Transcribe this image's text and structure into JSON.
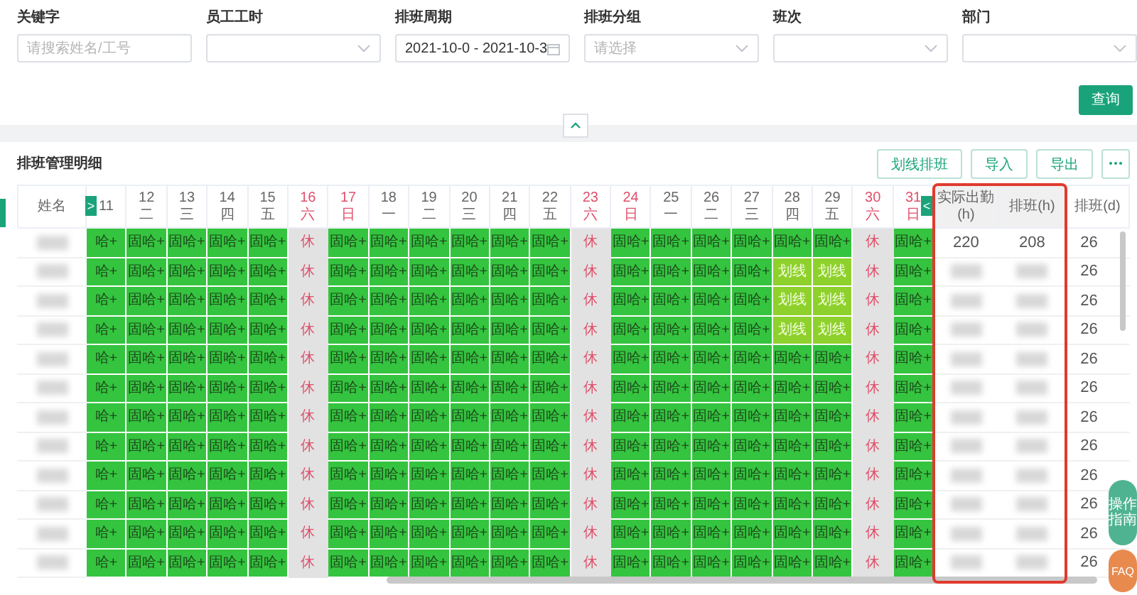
{
  "filters": [
    {
      "label": "关键字",
      "kind": "input",
      "placeholder": "请搜索姓名/工号"
    },
    {
      "label": "员工工时",
      "kind": "select"
    },
    {
      "label": "排班周期",
      "kind": "date",
      "value": "2021-10-0 - 2021-10-3"
    },
    {
      "label": "排班分组",
      "kind": "select",
      "placeholder": "请选择"
    },
    {
      "label": "班次",
      "kind": "select"
    },
    {
      "label": "部门",
      "kind": "select"
    }
  ],
  "query_button": "查询",
  "section_title": "排班管理明细",
  "toolbar_buttons": [
    "划线排班",
    "导入",
    "导出"
  ],
  "table": {
    "name_header": "姓名",
    "scroll_left": ">",
    "scroll_right": "<",
    "days": [
      {
        "day": "11",
        "weekend": false
      },
      {
        "day": "12",
        "weekday": "二",
        "weekend": false
      },
      {
        "day": "13",
        "weekday": "三",
        "weekend": false
      },
      {
        "day": "14",
        "weekday": "四",
        "weekend": false
      },
      {
        "day": "15",
        "weekday": "五",
        "weekend": false
      },
      {
        "day": "16",
        "weekday": "六",
        "weekend": true
      },
      {
        "day": "17",
        "weekday": "日",
        "weekend": true
      },
      {
        "day": "18",
        "weekday": "一",
        "weekend": false
      },
      {
        "day": "19",
        "weekday": "二",
        "weekend": false
      },
      {
        "day": "20",
        "weekday": "三",
        "weekend": false
      },
      {
        "day": "21",
        "weekday": "四",
        "weekend": false
      },
      {
        "day": "22",
        "weekday": "五",
        "weekend": false
      },
      {
        "day": "23",
        "weekday": "六",
        "weekend": true
      },
      {
        "day": "24",
        "weekday": "日",
        "weekend": true
      },
      {
        "day": "25",
        "weekday": "一",
        "weekend": false
      },
      {
        "day": "26",
        "weekday": "二",
        "weekend": false
      },
      {
        "day": "27",
        "weekday": "三",
        "weekend": false
      },
      {
        "day": "28",
        "weekday": "四",
        "weekend": false
      },
      {
        "day": "29",
        "weekday": "五",
        "weekend": false
      },
      {
        "day": "30",
        "weekday": "六",
        "weekend": true
      },
      {
        "day": "31",
        "weekday": "日",
        "weekend": true
      }
    ],
    "summary_headers": [
      {
        "text": "实际出勤(h)",
        "highlighted": true
      },
      {
        "text": "排班(h)",
        "highlighted": true
      },
      {
        "text": "排班(d)",
        "highlighted": false
      }
    ],
    "rows": [
      {
        "cells": [
          "哈+",
          "固哈+",
          "固哈+",
          "固哈+",
          "固哈+",
          "休",
          "固哈+",
          "固哈+",
          "固哈+",
          "固哈+",
          "固哈+",
          "固哈+",
          "休",
          "固哈+",
          "固哈+",
          "固哈+",
          "固哈+",
          "固哈+",
          "固哈+",
          "休",
          "固哈+"
        ],
        "actual_hours": "220",
        "scheduled_hours": "208",
        "scheduled_days": "26"
      },
      {
        "cells": [
          "哈+",
          "固哈+",
          "固哈+",
          "固哈+",
          "固哈+",
          "休",
          "固哈+",
          "固哈+",
          "固哈+",
          "固哈+",
          "固哈+",
          "固哈+",
          "休",
          "固哈+",
          "固哈+",
          "固哈+",
          "固哈+",
          "划线",
          "划线",
          "休",
          "固哈+"
        ],
        "scheduled_days": "26"
      },
      {
        "cells": [
          "哈+",
          "固哈+",
          "固哈+",
          "固哈+",
          "固哈+",
          "休",
          "固哈+",
          "固哈+",
          "固哈+",
          "固哈+",
          "固哈+",
          "固哈+",
          "休",
          "固哈+",
          "固哈+",
          "固哈+",
          "固哈+",
          "划线",
          "划线",
          "休",
          "固哈+"
        ],
        "scheduled_days": "26"
      },
      {
        "cells": [
          "哈+",
          "固哈+",
          "固哈+",
          "固哈+",
          "固哈+",
          "休",
          "固哈+",
          "固哈+",
          "固哈+",
          "固哈+",
          "固哈+",
          "固哈+",
          "休",
          "固哈+",
          "固哈+",
          "固哈+",
          "固哈+",
          "划线",
          "划线",
          "休",
          "固哈+"
        ],
        "scheduled_days": "26"
      },
      {
        "cells": [
          "哈+",
          "固哈+",
          "固哈+",
          "固哈+",
          "固哈+",
          "休",
          "固哈+",
          "固哈+",
          "固哈+",
          "固哈+",
          "固哈+",
          "固哈+",
          "休",
          "固哈+",
          "固哈+",
          "固哈+",
          "固哈+",
          "固哈+",
          "固哈+",
          "休",
          "固哈+"
        ],
        "scheduled_days": "26"
      },
      {
        "cells": [
          "哈+",
          "固哈+",
          "固哈+",
          "固哈+",
          "固哈+",
          "休",
          "固哈+",
          "固哈+",
          "固哈+",
          "固哈+",
          "固哈+",
          "固哈+",
          "休",
          "固哈+",
          "固哈+",
          "固哈+",
          "固哈+",
          "固哈+",
          "固哈+",
          "休",
          "固哈+"
        ],
        "scheduled_days": "26"
      },
      {
        "cells": [
          "哈+",
          "固哈+",
          "固哈+",
          "固哈+",
          "固哈+",
          "休",
          "固哈+",
          "固哈+",
          "固哈+",
          "固哈+",
          "固哈+",
          "固哈+",
          "休",
          "固哈+",
          "固哈+",
          "固哈+",
          "固哈+",
          "固哈+",
          "固哈+",
          "休",
          "固哈+"
        ],
        "scheduled_days": "26"
      },
      {
        "cells": [
          "哈+",
          "固哈+",
          "固哈+",
          "固哈+",
          "固哈+",
          "休",
          "固哈+",
          "固哈+",
          "固哈+",
          "固哈+",
          "固哈+",
          "固哈+",
          "休",
          "固哈+",
          "固哈+",
          "固哈+",
          "固哈+",
          "固哈+",
          "固哈+",
          "休",
          "固哈+"
        ],
        "scheduled_days": "26"
      },
      {
        "cells": [
          "哈+",
          "固哈+",
          "固哈+",
          "固哈+",
          "固哈+",
          "休",
          "固哈+",
          "固哈+",
          "固哈+",
          "固哈+",
          "固哈+",
          "固哈+",
          "休",
          "固哈+",
          "固哈+",
          "固哈+",
          "固哈+",
          "固哈+",
          "固哈+",
          "休",
          "固哈+"
        ],
        "scheduled_days": "26"
      },
      {
        "cells": [
          "哈+",
          "固哈+",
          "固哈+",
          "固哈+",
          "固哈+",
          "休",
          "固哈+",
          "固哈+",
          "固哈+",
          "固哈+",
          "固哈+",
          "固哈+",
          "休",
          "固哈+",
          "固哈+",
          "固哈+",
          "固哈+",
          "固哈+",
          "固哈+",
          "休",
          "固哈+"
        ],
        "scheduled_days": "26"
      },
      {
        "cells": [
          "哈+",
          "固哈+",
          "固哈+",
          "固哈+",
          "固哈+",
          "休",
          "固哈+",
          "固哈+",
          "固哈+",
          "固哈+",
          "固哈+",
          "固哈+",
          "休",
          "固哈+",
          "固哈+",
          "固哈+",
          "固哈+",
          "固哈+",
          "固哈+",
          "休",
          "固哈+"
        ],
        "scheduled_days": "26"
      },
      {
        "cells": [
          "哈+",
          "固哈+",
          "固哈+",
          "固哈+",
          "固哈+",
          "休",
          "固哈+",
          "固哈+",
          "固哈+",
          "固哈+",
          "固哈+",
          "固哈+",
          "休",
          "固哈+",
          "固哈+",
          "固哈+",
          "固哈+",
          "固哈+",
          "固哈+",
          "休",
          "固哈+"
        ],
        "scheduled_days": "26"
      }
    ]
  },
  "float_buttons": [
    {
      "text": "操作指南",
      "kind": "guide"
    },
    {
      "text": "FAQ",
      "kind": "faq"
    }
  ]
}
